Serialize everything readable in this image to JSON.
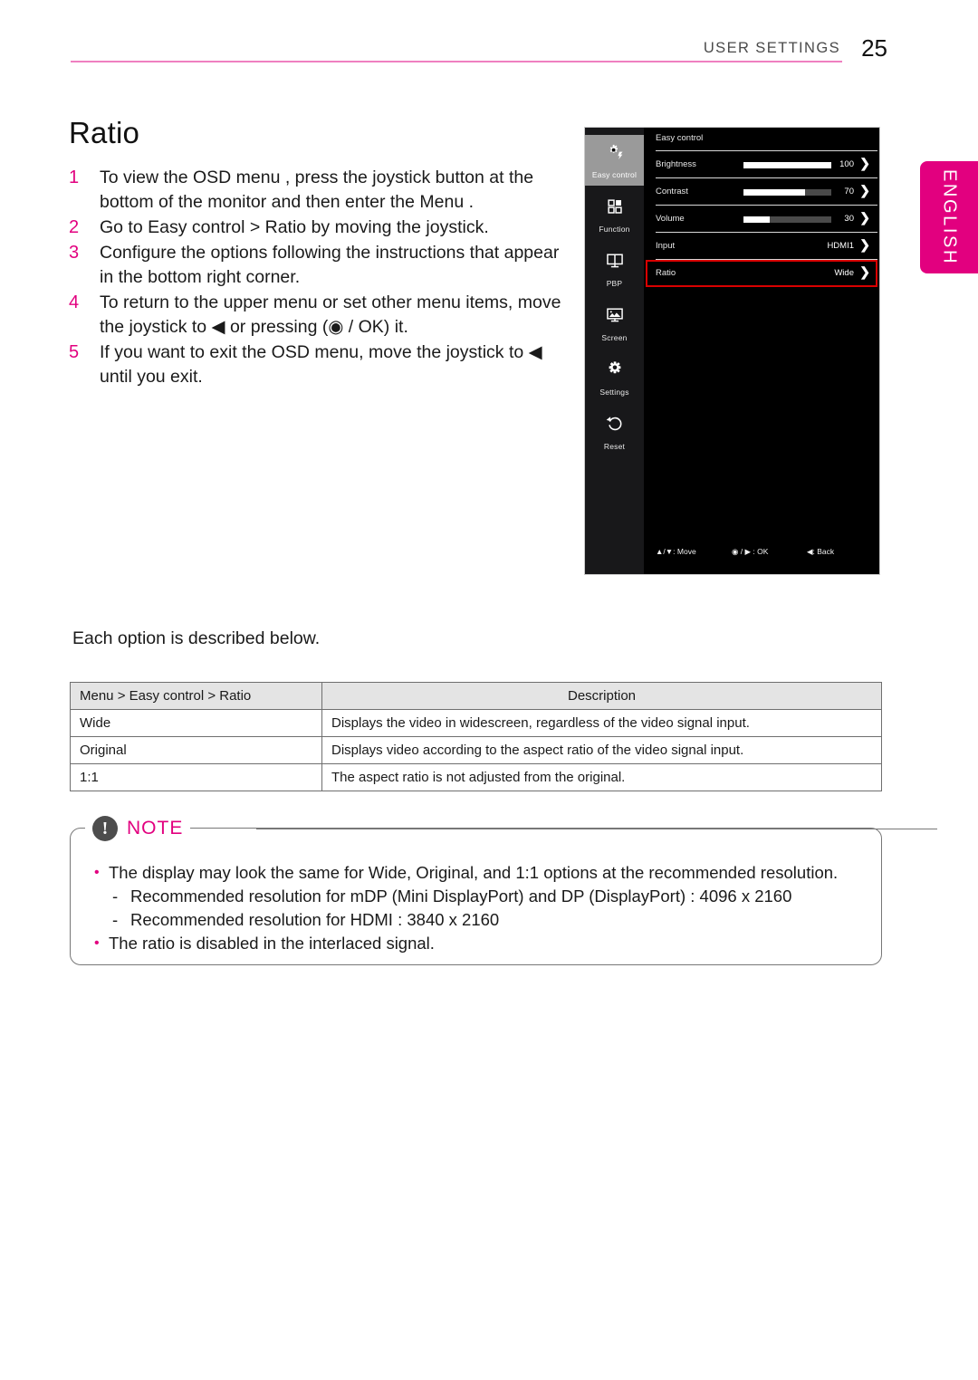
{
  "header": {
    "title": "USER SETTINGS",
    "page_number": "25",
    "language_tab": "ENGLISH"
  },
  "section": {
    "title": "Ratio",
    "steps": [
      {
        "num": "1",
        "text": "To view the OSD menu , press the joystick button    at the bottom of the monitor and then enter the Menu ."
      },
      {
        "num": "2",
        "text": "Go to Easy control > Ratio   by moving the joystick."
      },
      {
        "num": "3",
        "text": "Configure the options following the instructions that appear in the bottom right corner."
      },
      {
        "num": "4",
        "text": "To return to the upper menu or set other menu items, move the joystick to ◀ or pressing (◉ / OK) it."
      },
      {
        "num": "5",
        "text": "If you want to exit the OSD menu, move the joystick to ◀ until you exit."
      }
    ],
    "each_option_line": "Each option is described below."
  },
  "osd": {
    "header_label": "Easy control",
    "sidebar": [
      {
        "label": "Easy control",
        "icon": "brightness-bolt-icon",
        "selected": true
      },
      {
        "label": "Function",
        "icon": "function-grid-icon",
        "selected": false
      },
      {
        "label": "PBP",
        "icon": "pbp-split-screen-icon",
        "selected": false
      },
      {
        "label": "Screen",
        "icon": "screen-picture-icon",
        "selected": false
      },
      {
        "label": "Settings",
        "icon": "gear-icon",
        "selected": false
      },
      {
        "label": "Reset",
        "icon": "reset-arrow-icon",
        "selected": false
      }
    ],
    "rows": [
      {
        "name": "Brightness",
        "value": "100",
        "slider": 100,
        "has_slider": true,
        "highlighted": false
      },
      {
        "name": "Contrast",
        "value": "70",
        "slider": 70,
        "has_slider": true,
        "highlighted": false
      },
      {
        "name": "Volume",
        "value": "30",
        "slider": 30,
        "has_slider": true,
        "highlighted": false
      },
      {
        "name": "Input",
        "value": "HDMI1",
        "slider": 0,
        "has_slider": false,
        "highlighted": false
      },
      {
        "name": "Ratio",
        "value": "Wide",
        "slider": 0,
        "has_slider": false,
        "highlighted": true
      }
    ],
    "footer": {
      "move": "▲/▼: Move",
      "ok": "◉ / ▶ : OK",
      "back": "◀: Back"
    },
    "highlight_color": "#d90000"
  },
  "table": {
    "headers": [
      "Menu > Easy control > Ratio",
      "Description"
    ],
    "rows": [
      [
        "Wide",
        "Displays the video in widescreen, regardless of the video signal input."
      ],
      [
        "Original",
        "Displays video according to the aspect ratio of the video signal input."
      ],
      [
        "1:1",
        "The aspect ratio is not adjusted from the original."
      ]
    ]
  },
  "note": {
    "title": "NOTE",
    "items": [
      {
        "type": "bullet",
        "text": "The display may look the same for Wide, Original, and 1:1 options at the recommended resolution."
      },
      {
        "type": "dash",
        "text": "Recommended resolution for mDP (Mini DisplayPort) and DP (DisplayPort) : 4096 x 2160"
      },
      {
        "type": "dash",
        "text": "Recommended resolution for HDMI : 3840 x 2160"
      },
      {
        "type": "bullet",
        "text": "The ratio is disabled in the interlaced signal."
      }
    ]
  },
  "colors": {
    "accent": "#e2007f",
    "rule": "#ef7fc0"
  }
}
